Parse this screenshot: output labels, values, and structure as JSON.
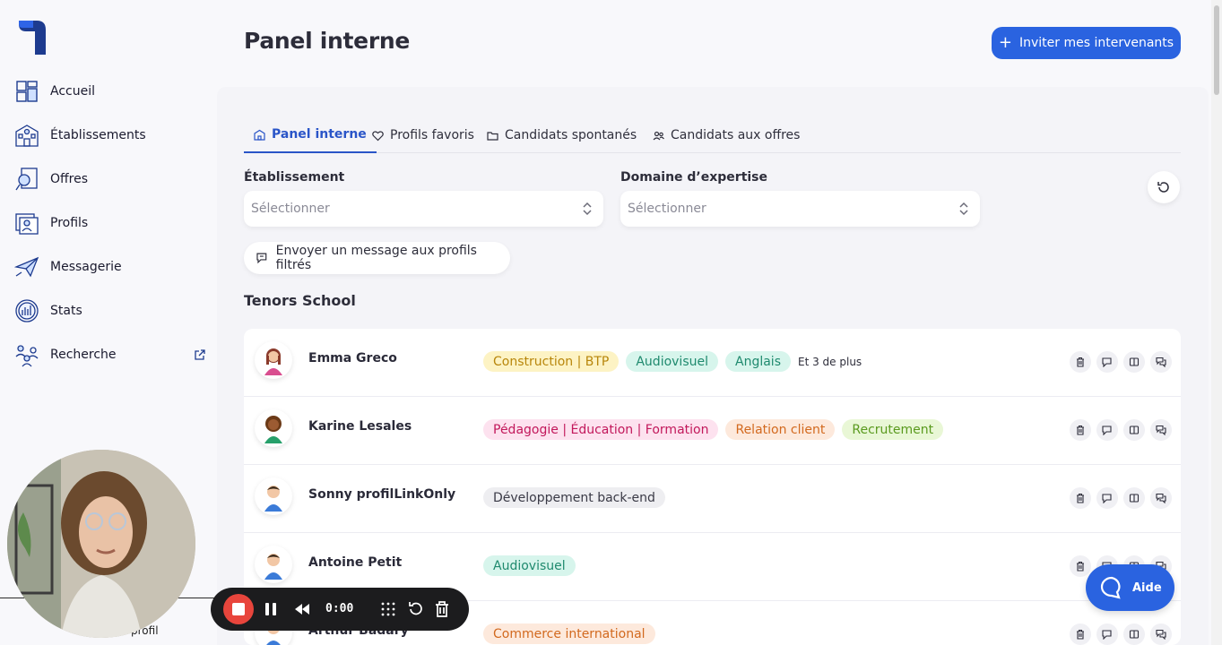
{
  "page": {
    "title": "Panel interne"
  },
  "header": {
    "invite_label": "Inviter mes intervenants",
    "invite_icon": "plus-icon"
  },
  "sidebar": {
    "items": [
      {
        "label": "Accueil",
        "icon": "dashboard-icon"
      },
      {
        "label": "Établissements",
        "icon": "school-building-icon"
      },
      {
        "label": "Offres",
        "icon": "search-document-icon"
      },
      {
        "label": "Profils",
        "icon": "profile-card-icon"
      },
      {
        "label": "Messagerie",
        "icon": "paper-plane-icon"
      },
      {
        "label": "Stats",
        "icon": "stats-chart-icon"
      },
      {
        "label": "Recherche",
        "icon": "people-network-icon"
      }
    ]
  },
  "tabs": [
    {
      "label": "Panel interne",
      "icon": "building-icon",
      "active": true
    },
    {
      "label": "Profils favoris",
      "icon": "heart-icon",
      "active": false
    },
    {
      "label": "Candidats spontanés",
      "icon": "folder-icon",
      "active": false
    },
    {
      "label": "Candidats aux offres",
      "icon": "users-icon",
      "active": false
    }
  ],
  "filters": {
    "etablissement": {
      "label": "Établissement",
      "placeholder": "Sélectionner"
    },
    "domaine": {
      "label": "Domaine d’expertise",
      "placeholder": "Sélectionner"
    }
  },
  "message_button": "Envoyer un message aux profils filtrés",
  "group": {
    "title": "Tenors School"
  },
  "profiles": [
    {
      "name": "Emma Greco",
      "tags": [
        {
          "label": "Construction | BTP",
          "bg": "#fdf3c4",
          "fg": "#b8860b"
        },
        {
          "label": "Audiovisuel",
          "bg": "#d7f5ec",
          "fg": "#1f8a6e"
        },
        {
          "label": "Anglais",
          "bg": "#d7f5ec",
          "fg": "#1f8a6e"
        }
      ],
      "more": "Et 3 de plus"
    },
    {
      "name": "Karine Lesales",
      "tags": [
        {
          "label": "Pédagogie | Éducation | Formation",
          "bg": "#fde2ef",
          "fg": "#c2185b"
        },
        {
          "label": "Relation client",
          "bg": "#fde9dc",
          "fg": "#d2691e"
        },
        {
          "label": "Recrutement",
          "bg": "#e9f7d6",
          "fg": "#5a9a1e"
        }
      ],
      "more": ""
    },
    {
      "name": "Sonny profilLinkOnly",
      "tags": [
        {
          "label": "Développement back-end",
          "bg": "#eeeef1",
          "fg": "#3a3a46"
        }
      ],
      "more": ""
    },
    {
      "name": "Antoine Petit",
      "tags": [
        {
          "label": "Audiovisuel",
          "bg": "#d7f5ec",
          "fg": "#1f8a6e"
        }
      ],
      "more": ""
    },
    {
      "name": "Arthur Badary",
      "tags": [
        {
          "label": "Commerce international",
          "bg": "#fde9dc",
          "fg": "#d2691e"
        }
      ],
      "more": ""
    }
  ],
  "row_actions": [
    "trash-icon",
    "message-icon",
    "book-icon",
    "chat-bubbles-icon"
  ],
  "overlay": {
    "profil_text": "profil"
  },
  "recorder": {
    "time": "0:00"
  },
  "help": {
    "label": "Aide"
  },
  "colors": {
    "primary": "#2a63e0",
    "active_tab": "#2a55c8",
    "record": "#e8453c"
  }
}
